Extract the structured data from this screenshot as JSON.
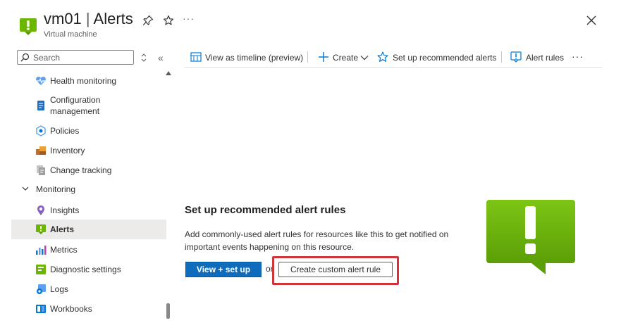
{
  "header": {
    "resource_name": "vm01",
    "separator": "|",
    "page_name": "Alerts",
    "subtitle": "Virtual machine",
    "more": "···"
  },
  "sidebar": {
    "search_placeholder": "Search",
    "collapse": "«",
    "items_before": [
      {
        "label": "Health monitoring",
        "icon": "heart-pulse-icon"
      },
      {
        "label": "Configuration\nmanagement",
        "icon": "document-icon"
      },
      {
        "label": "Policies",
        "icon": "policy-gear-icon"
      },
      {
        "label": "Inventory",
        "icon": "inventory-box-icon"
      },
      {
        "label": "Change tracking",
        "icon": "change-tracking-icon"
      }
    ],
    "group": {
      "label": "Monitoring",
      "expanded": true
    },
    "monitoring_items": [
      {
        "label": "Insights",
        "icon": "lightbulb-pin-icon",
        "active": false
      },
      {
        "label": "Alerts",
        "icon": "alert-icon",
        "active": true
      },
      {
        "label": "Metrics",
        "icon": "metrics-bar-icon",
        "active": false
      },
      {
        "label": "Diagnostic settings",
        "icon": "diagnostic-settings-icon",
        "active": false
      },
      {
        "label": "Logs",
        "icon": "logs-icon",
        "active": false
      },
      {
        "label": "Workbooks",
        "icon": "workbook-icon",
        "active": false
      }
    ]
  },
  "toolbar": {
    "timeline": "View as timeline (preview)",
    "create": "Create",
    "recommended": "Set up recommended alerts",
    "alert_rules": "Alert rules",
    "more": "···"
  },
  "empty_state": {
    "title": "Set up recommended alert rules",
    "description": "Add commonly-used alert rules for resources like this to get notified on important events happening on this resource.",
    "primary_button": "View + set up",
    "or": "or",
    "secondary_button": "Create custom alert rule"
  },
  "colors": {
    "accent": "#0f6cbd",
    "alert_green": "#6bb700",
    "highlight_red": "#d13438",
    "active_bg": "#edebe9"
  }
}
